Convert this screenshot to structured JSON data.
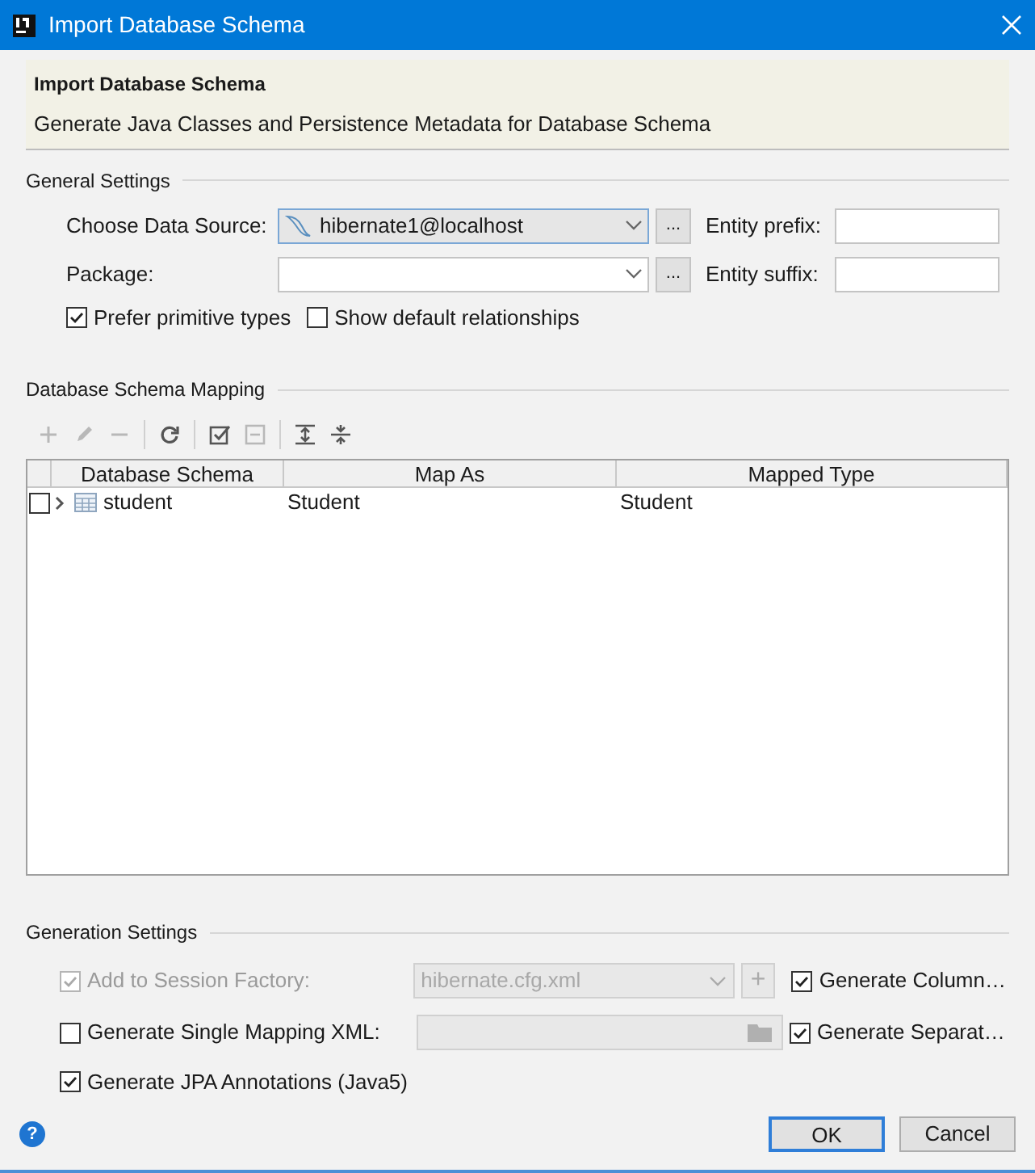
{
  "window": {
    "title": "Import Database Schema"
  },
  "header": {
    "title": "Import Database Schema",
    "subtitle": "Generate Java Classes and Persistence Metadata for Database Schema"
  },
  "general_settings": {
    "title": "General Settings",
    "data_source": {
      "label": "Choose Data Source:",
      "value": "hibernate1@localhost",
      "browse": "..."
    },
    "package": {
      "label": "Package:",
      "browse": "..."
    },
    "entity_prefix": {
      "label": "Entity prefix:"
    },
    "entity_suffix": {
      "label": "Entity suffix:"
    },
    "options": [
      {
        "label": "Prefer primitive types",
        "checked": true
      },
      {
        "label": "Show default relationships",
        "checked": false
      }
    ]
  },
  "mapping": {
    "title": "Database Schema Mapping",
    "toolbar": [
      {
        "kind": "add",
        "disabled": true
      },
      {
        "kind": "edit",
        "disabled": true
      },
      {
        "kind": "remove",
        "disabled": true
      },
      {
        "kind": "sep"
      },
      {
        "kind": "refresh",
        "disabled": false
      },
      {
        "kind": "sep"
      },
      {
        "kind": "check_all",
        "disabled": false
      },
      {
        "kind": "uncheck_all",
        "disabled": true
      },
      {
        "kind": "sep"
      },
      {
        "kind": "expand_all",
        "disabled": false
      },
      {
        "kind": "collapse_all",
        "disabled": false
      }
    ],
    "columns": [
      "Database Schema",
      "Map As",
      "Mapped Type"
    ],
    "rows": [
      {
        "checked": false,
        "expanded": false,
        "schema": "student",
        "map_as": "Student",
        "mapped_type": "Student"
      }
    ]
  },
  "generation_settings": {
    "title": "Generation Settings",
    "add_to_session_factory": {
      "label": "Add to Session Factory:",
      "checked": true,
      "disabled": true,
      "value": "hibernate.cfg.xml",
      "button": "+"
    },
    "single_mapping_xml": {
      "label": "Generate Single Mapping XML:",
      "checked": false
    },
    "generate_columns": {
      "label": "Generate Column…",
      "checked": true
    },
    "generate_separate": {
      "label": "Generate Separat…",
      "checked": true
    },
    "jpa_annotations": {
      "label": "Generate JPA Annotations (Java5)",
      "checked": true
    }
  },
  "buttons": [
    {
      "label": "OK",
      "default": true
    },
    {
      "label": "Cancel",
      "default": false
    }
  ],
  "help": "?"
}
